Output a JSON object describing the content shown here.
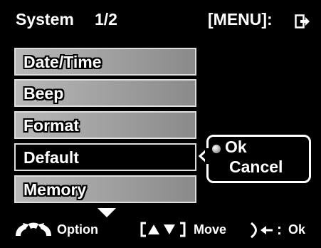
{
  "header": {
    "title": "System",
    "page": "1/2",
    "menu_hint": "[MENU]:"
  },
  "menu": {
    "items": [
      {
        "label": "Date/Time",
        "selected": false
      },
      {
        "label": "Beep",
        "selected": false
      },
      {
        "label": "Format",
        "selected": false
      },
      {
        "label": "Default",
        "selected": true
      },
      {
        "label": "Memory",
        "selected": false
      }
    ]
  },
  "popup": {
    "options": [
      "Ok",
      "Cancel"
    ],
    "selected_option": "Ok"
  },
  "footer": {
    "option_label": "Option",
    "move_label": "Move",
    "ok_label": "Ok"
  },
  "icons": {
    "exit": "exit-arrow-icon",
    "option": "option-arcs-icon",
    "scroll": "scroll-down-arrow-icon",
    "updown": "up-down-arrows-icon",
    "dial": "dial-enter-icon"
  },
  "colors": {
    "background": "#000000",
    "item_fill": "#9c9c9c",
    "item_border": "#dedede",
    "text": "#ffffff"
  }
}
